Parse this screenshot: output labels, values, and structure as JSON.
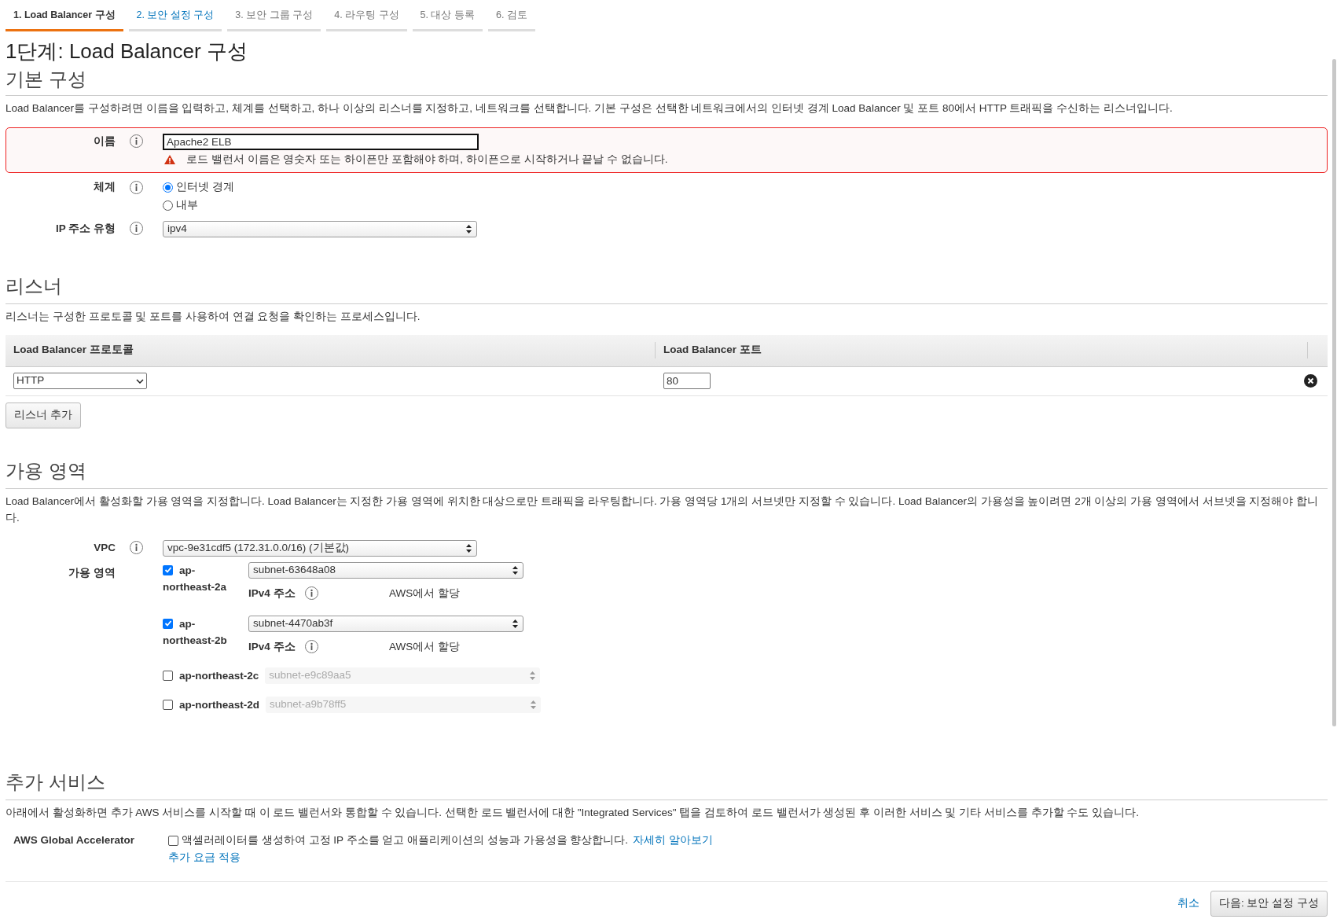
{
  "tabs": [
    {
      "label": "1. Load Balancer 구성",
      "selected": true,
      "disabled": false
    },
    {
      "label": "2. 보안 설정 구성",
      "selected": false,
      "disabled": false
    },
    {
      "label": "3. 보안 그룹 구성",
      "selected": false,
      "disabled": true
    },
    {
      "label": "4. 라우팅 구성",
      "selected": false,
      "disabled": true
    },
    {
      "label": "5. 대상 등록",
      "selected": false,
      "disabled": true
    },
    {
      "label": "6. 검토",
      "selected": false,
      "disabled": true
    }
  ],
  "page_title": "1단계: Load Balancer 구성",
  "basic": {
    "heading": "기본 구성",
    "description": "Load Balancer를 구성하려면 이름을 입력하고, 체계를 선택하고, 하나 이상의 리스너를 지정하고, 네트워크를 선택합니다. 기본 구성은 선택한 네트워크에서의 인터넷 경계 Load Balancer 및 포트 80에서 HTTP 트래픽을 수신하는 리스너입니다.",
    "name": {
      "label": "이름",
      "value": "Apache2 ELB",
      "error": "로드 밸런서 이름은 영숫자 또는 하이픈만 포함해야 하며, 하이픈으로 시작하거나 끝날 수 없습니다."
    },
    "scheme": {
      "label": "체계",
      "options": [
        {
          "label": "인터넷 경계",
          "selected": true
        },
        {
          "label": "내부",
          "selected": false
        }
      ]
    },
    "ip_type": {
      "label": "IP 주소 유형",
      "value": "ipv4"
    }
  },
  "listeners": {
    "heading": "리스너",
    "description": "리스너는 구성한 프로토콜 및 포트를 사용하여 연결 요청을 확인하는 프로세스입니다.",
    "columns": [
      "Load Balancer 프로토콜",
      "Load Balancer 포트"
    ],
    "rows": [
      {
        "protocol": "HTTP",
        "port": "80"
      }
    ],
    "add_button": "리스너 추가"
  },
  "availability": {
    "heading": "가용 영역",
    "description": "Load Balancer에서 활성화할 가용 영역을 지정합니다. Load Balancer는 지정한 가용 영역에 위치한 대상으로만 트래픽을 라우팅합니다. 가용 영역당 1개의 서브넷만 지정할 수 있습니다. Load Balancer의 가용성을 높이려면 2개 이상의 가용 영역에서 서브넷을 지정해야 합니다.",
    "vpc": {
      "label": "VPC",
      "value": "vpc-9e31cdf5 (172.31.0.0/16) (기본값)"
    },
    "zones_label": "가용 영역",
    "zones": [
      {
        "name": "ap-northeast-2a",
        "checked": true,
        "subnet": "subnet-63648a08",
        "ipv4_label": "IPv4 주소",
        "ipv4_value": "AWS에서 할당"
      },
      {
        "name": "ap-northeast-2b",
        "checked": true,
        "subnet": "subnet-4470ab3f",
        "ipv4_label": "IPv4 주소",
        "ipv4_value": "AWS에서 할당"
      },
      {
        "name": "ap-northeast-2c",
        "checked": false,
        "subnet": "subnet-e9c89aa5"
      },
      {
        "name": "ap-northeast-2d",
        "checked": false,
        "subnet": "subnet-a9b78ff5"
      }
    ]
  },
  "additional": {
    "heading": "추가 서비스",
    "description": "아래에서 활성화하면 추가 AWS 서비스를 시작할 때 이 로드 밸런서와 통합할 수 있습니다. 선택한 로드 밸런서에 대한 \"Integrated Services\" 탭을 검토하여 로드 밸런서가 생성된 후 이러한 서비스 및 기타 서비스를 추가할 수도 있습니다.",
    "items": [
      {
        "label": "AWS Global Accelerator",
        "checked": false,
        "text": "액셀러레이터를 생성하여 고정 IP 주소를 얻고 애플리케이션의 성능과 가용성을 향상합니다.",
        "link": "자세히 알아보기",
        "note": "추가 요금 적용"
      }
    ]
  },
  "footer": {
    "cancel": "취소",
    "next": "다음: 보안 설정 구성"
  }
}
